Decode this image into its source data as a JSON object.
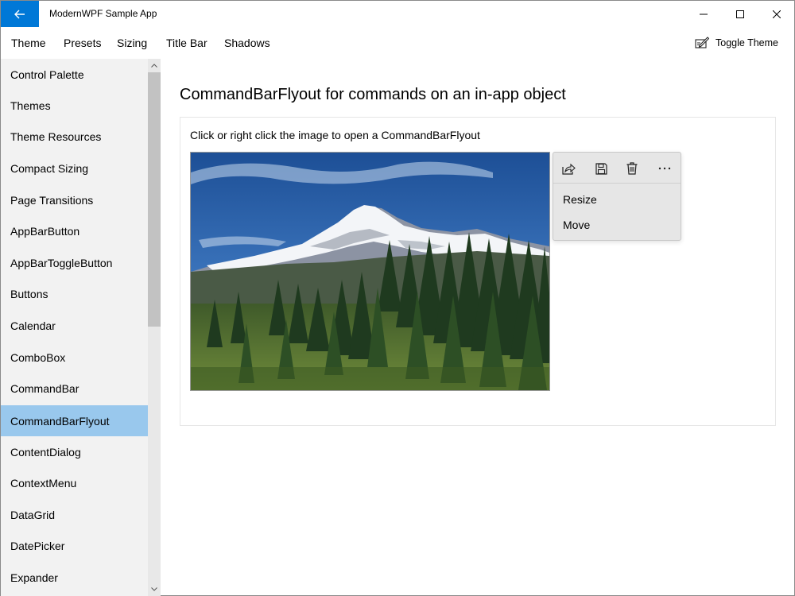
{
  "window": {
    "title": "ModernWPF Sample App"
  },
  "menu": {
    "items": [
      "Theme",
      "Presets",
      "Sizing",
      "Title Bar",
      "Shadows"
    ],
    "toggle_theme_label": "Toggle Theme"
  },
  "sidebar": {
    "selected": "CommandBarFlyout",
    "items": [
      "Control Palette",
      "Themes",
      "Theme Resources",
      "Compact Sizing",
      "Page Transitions",
      "AppBarButton",
      "AppBarToggleButton",
      "Buttons",
      "Calendar",
      "ComboBox",
      "CommandBar",
      "CommandBarFlyout",
      "ContentDialog",
      "ContextMenu",
      "DataGrid",
      "DatePicker",
      "Expander"
    ]
  },
  "content": {
    "heading": "CommandBarFlyout for commands on an in-app object",
    "caption": "Click or right click the image to open a CommandBarFlyout"
  },
  "flyout": {
    "primary_commands": [
      "share-icon",
      "save-icon",
      "delete-icon",
      "more-icon"
    ],
    "secondary_commands": [
      "Resize",
      "Move"
    ]
  },
  "colors": {
    "accent": "#0078d7",
    "selected_nav": "#99c8ed",
    "sidebar_bg": "#f2f2f2",
    "flyout_bg": "#e6e6e6"
  }
}
